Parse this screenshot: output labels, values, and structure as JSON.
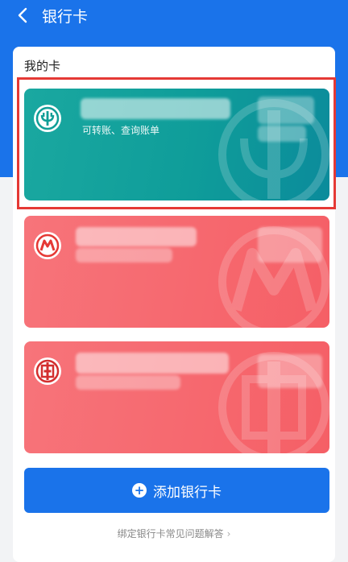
{
  "header": {
    "title": "银行卡"
  },
  "section": {
    "title": "我的卡"
  },
  "cards": [
    {
      "subtitle": "可转账、查询账单",
      "bank_icon": "abc-logo-icon",
      "color": "#0f9d9a"
    },
    {
      "subtitle": "",
      "bank_icon": "cmb-logo-icon",
      "color": "#f55f66"
    },
    {
      "subtitle": "",
      "bank_icon": "icbc-logo-icon",
      "color": "#f55f66"
    }
  ],
  "actions": {
    "add_card_label": "添加银行卡"
  },
  "footer": {
    "faq_label": "绑定银行卡常见问题解答",
    "chevron": "›"
  },
  "colors": {
    "brand": "#1a73ea",
    "highlight": "#e53935"
  }
}
